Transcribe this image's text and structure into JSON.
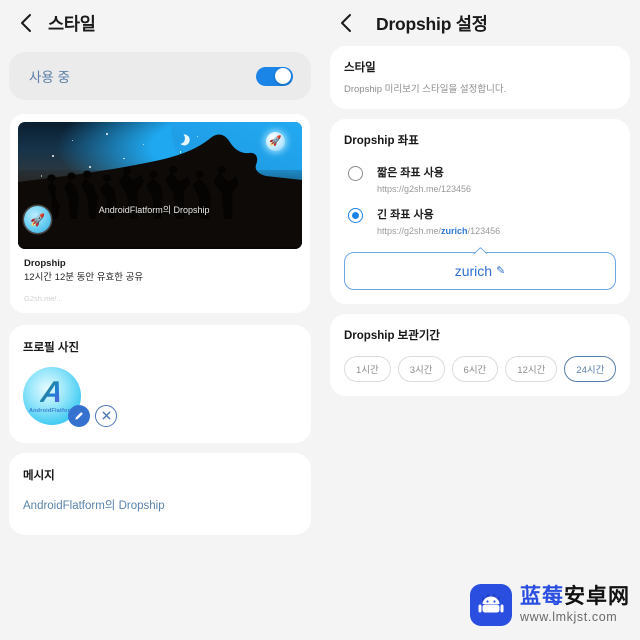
{
  "left": {
    "header": {
      "back_icon": "chevron-left-icon",
      "title": "스타일"
    },
    "toggle": {
      "label": "사용 중",
      "state": "on"
    },
    "preview": {
      "image_caption": "AndroidFlatform의 Dropship",
      "title": "Dropship",
      "subtitle": "12시간 12분 동안 유효한 공유",
      "url": "G2sh.me/...",
      "avatar_icon": "rocket-icon",
      "badge_icon": "rocket-badge-icon"
    },
    "profile": {
      "title": "프로필 사진",
      "avatar_letter": "A",
      "avatar_subtext": "AndroidFlatform",
      "edit_icon": "pencil-icon",
      "delete_icon": "close-circle-icon"
    },
    "message": {
      "title": "메시지",
      "text": "AndroidFlatform의 Dropship"
    }
  },
  "right": {
    "header": {
      "back_icon": "chevron-left-icon",
      "title": "Dropship 설정"
    },
    "style_card": {
      "title": "스타일",
      "subtitle": "Dropship 미리보기 스타일을 설정합니다."
    },
    "coords_card": {
      "title": "Dropship 좌표",
      "options": [
        {
          "label": "짧은 좌표 사용",
          "url_prefix": "https://g2sh.me/123456",
          "url_highlight": "",
          "url_suffix": "",
          "selected": false
        },
        {
          "label": "긴 좌표 사용",
          "url_prefix": "https://g2sh.me/",
          "url_highlight": "zurich",
          "url_suffix": "/123456",
          "selected": true
        }
      ],
      "editor": {
        "value": "zurich",
        "edit_icon": "pencil-icon"
      }
    },
    "retention_card": {
      "title": "Dropship 보관기간",
      "chips": [
        {
          "label": "1시간",
          "selected": false
        },
        {
          "label": "3시간",
          "selected": false
        },
        {
          "label": "6시간",
          "selected": false
        },
        {
          "label": "12시간",
          "selected": false
        },
        {
          "label": "24시간",
          "selected": true
        }
      ]
    }
  },
  "watermark": {
    "cn_blue": "蓝莓",
    "cn_black": "安卓网",
    "url": "www.lmkjst.com",
    "logo_icon": "android-crown-icon"
  },
  "colors": {
    "accent_blue": "#1b84e7",
    "link_blue": "#2f7ad6",
    "page_bg": "#f4f4f4",
    "card_bg": "#ffffff",
    "chip_selected_border": "#5a7fa8",
    "watermark_blue": "#2a4fe0"
  }
}
